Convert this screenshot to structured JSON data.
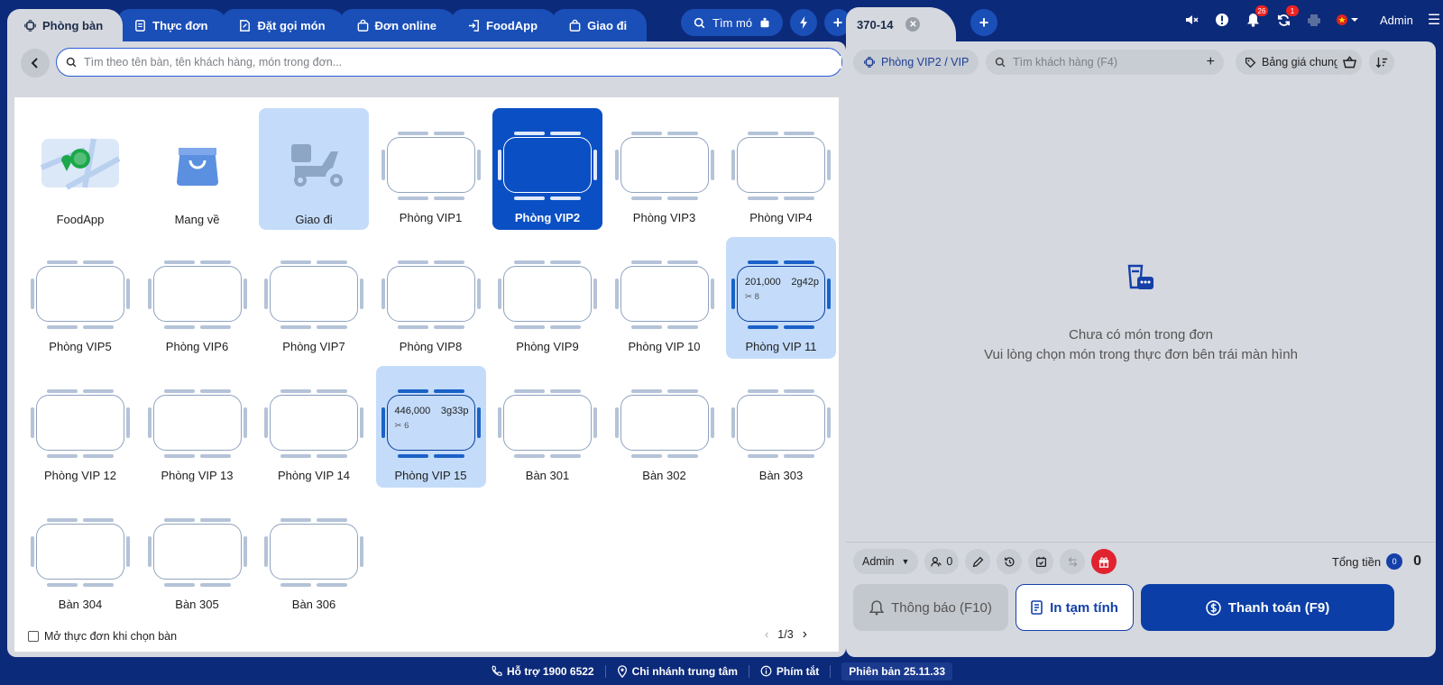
{
  "left_tabs": [
    {
      "label": "Phòng bàn",
      "icon": "table-icon",
      "active": true
    },
    {
      "label": "Thực đơn",
      "icon": "menu-icon",
      "active": false
    },
    {
      "label": "Đặt gọi món",
      "icon": "order-icon",
      "active": false
    },
    {
      "label": "Đơn online",
      "icon": "bag-icon",
      "active": false
    },
    {
      "label": "FoodApp",
      "icon": "login-icon",
      "active": false
    },
    {
      "label": "Giao đi",
      "icon": "bag-icon",
      "active": false
    }
  ],
  "top_actions": {
    "search_menu_label": "Tìm mó"
  },
  "table_search": {
    "placeholder": "Tìm theo tên bàn, tên khách hàng, món trong đơn..."
  },
  "tiles": [
    {
      "name": "FoodApp",
      "kind": "foodapp",
      "state": "normal"
    },
    {
      "name": "Mang về",
      "kind": "takeaway",
      "state": "normal"
    },
    {
      "name": "Giao đi",
      "kind": "delivery",
      "state": "light"
    },
    {
      "name": "Phòng VIP1",
      "kind": "table",
      "state": "normal"
    },
    {
      "name": "Phòng VIP2",
      "kind": "table",
      "state": "selected"
    },
    {
      "name": "Phòng VIP3",
      "kind": "table",
      "state": "normal"
    },
    {
      "name": "Phòng VIP4",
      "kind": "table",
      "state": "normal"
    },
    {
      "name": "Phòng VIP5",
      "kind": "table",
      "state": "normal"
    },
    {
      "name": "Phòng VIP6",
      "kind": "table",
      "state": "normal"
    },
    {
      "name": "Phòng VIP7",
      "kind": "table",
      "state": "normal"
    },
    {
      "name": "Phòng VIP8",
      "kind": "table",
      "state": "normal"
    },
    {
      "name": "Phòng VIP9",
      "kind": "table",
      "state": "normal"
    },
    {
      "name": "Phòng VIP 10",
      "kind": "table",
      "state": "normal"
    },
    {
      "name": "Phòng VIP 11",
      "kind": "table",
      "state": "occupied",
      "amount": "201,000",
      "duration": "2g42p",
      "guests": "8"
    },
    {
      "name": "Phòng VIP 12",
      "kind": "table",
      "state": "normal"
    },
    {
      "name": "Phòng VIP 13",
      "kind": "table",
      "state": "normal"
    },
    {
      "name": "Phòng VIP 14",
      "kind": "table",
      "state": "normal"
    },
    {
      "name": "Phòng VIP 15",
      "kind": "table",
      "state": "occupied",
      "amount": "446,000",
      "duration": "3g33p",
      "guests": "6"
    },
    {
      "name": "Bàn 301",
      "kind": "table",
      "state": "normal"
    },
    {
      "name": "Bàn 302",
      "kind": "table",
      "state": "normal"
    },
    {
      "name": "Bàn 303",
      "kind": "table",
      "state": "normal"
    },
    {
      "name": "Bàn 304",
      "kind": "table",
      "state": "normal"
    },
    {
      "name": "Bàn 305",
      "kind": "table",
      "state": "normal"
    },
    {
      "name": "Bàn 306",
      "kind": "table",
      "state": "normal"
    }
  ],
  "footer": {
    "open_menu_label": "Mở thực đơn khi chọn bàn",
    "page": "1/3"
  },
  "order": {
    "tab_label": "370-14",
    "room_chip": "Phòng VIP2 / VIP",
    "customer_search_placeholder": "Tìm khách hàng (F4)",
    "price_list": "Bảng giá chung",
    "empty_title": "Chưa có món trong đơn",
    "empty_subtitle": "Vui lòng chọn món trong thực đơn bên trái màn hình",
    "staff": "Admin",
    "guests": "0",
    "total_label": "Tổng tiền",
    "total_count": "0",
    "total_amount": "0",
    "notify_label": "Thông báo (F10)",
    "print_label": "In tạm tính",
    "pay_label": "Thanh toán (F9)"
  },
  "header_right": {
    "notifications": "26",
    "sync": "1",
    "user": "Admin"
  },
  "statusbar": {
    "support": "Hỗ trợ 1900 6522",
    "branch": "Chi nhánh trung tâm",
    "shortcuts": "Phím tắt",
    "version": "Phiên bản 25.11.33"
  },
  "colors": {
    "navy": "#0c2a7a",
    "primary": "#0b3ea6",
    "selected": "#0a4fc4",
    "light": "#c4dcfa",
    "panel": "#d5d8de",
    "danger": "#e0232f"
  }
}
